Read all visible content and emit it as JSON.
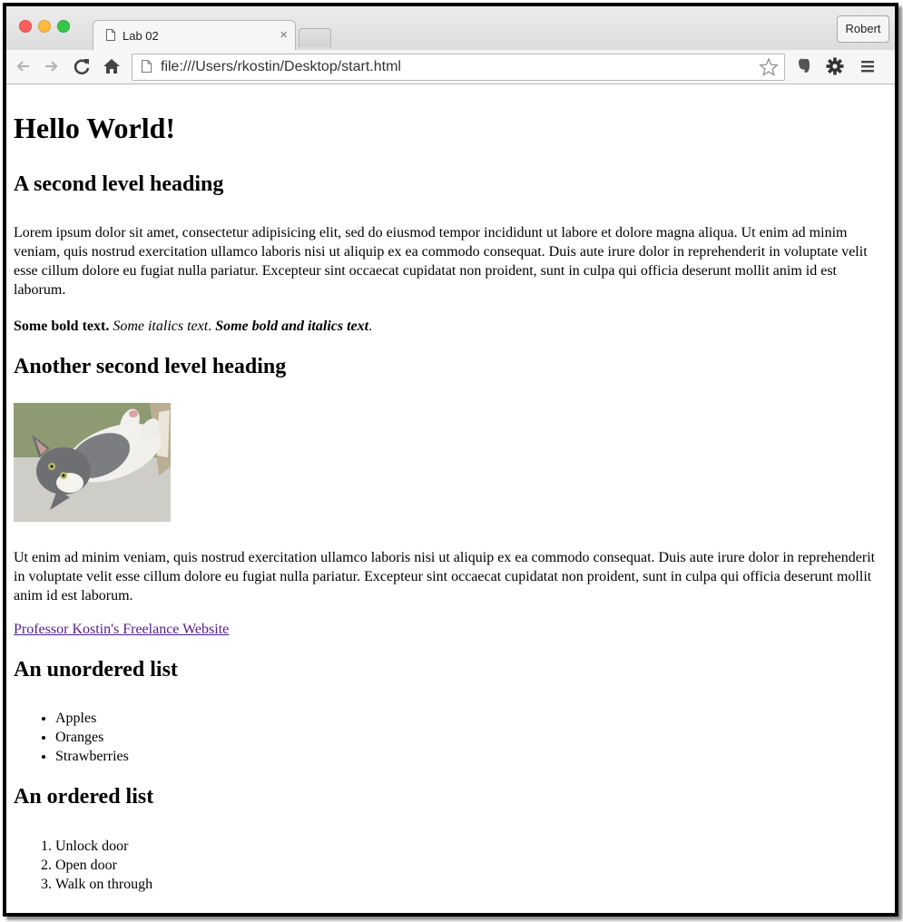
{
  "browser": {
    "tab_title": "Lab 02",
    "tab_close": "×",
    "profile_label": "Robert",
    "url": "file:///Users/rkostin/Desktop/start.html",
    "icons": [
      "back-icon",
      "forward-icon",
      "reload-icon",
      "home-icon",
      "bookmark-star-icon",
      "evernote-icon",
      "settings-gear-icon",
      "menu-icon"
    ]
  },
  "page": {
    "h1": "Hello World!",
    "h2_first": "A second level heading",
    "paragraph_1": "Lorem ipsum dolor sit amet, consectetur adipisicing elit, sed do eiusmod tempor incididunt ut labore et dolore magna aliqua. Ut enim ad minim veniam, quis nostrud exercitation ullamco laboris nisi ut aliquip ex ea commodo consequat. Duis aute irure dolor in reprehenderit in voluptate velit esse cillum dolore eu fugiat nulla pariatur. Excepteur sint occaecat cupidatat non proident, sunt in culpa qui officia deserunt mollit anim id est laborum.",
    "bold_text": "Some bold text.",
    "italic_text": "Some italics text",
    "bold_italic_text": "Some bold and italics text",
    "sep_1": ". ",
    "sep_2": ".",
    "h2_second": "Another second level heading",
    "paragraph_2": "Ut enim ad minim veniam, quis nostrud exercitation ullamco laboris nisi ut aliquip ex ea commodo consequat. Duis aute irure dolor in reprehenderit in voluptate velit esse cillum dolore eu fugiat nulla pariatur. Excepteur sint occaecat cupidatat non proident, sunt in culpa qui officia deserunt mollit anim id est laborum.",
    "link_text": "Professor Kostin's Freelance Website",
    "h2_unordered": "An unordered list",
    "unordered_items": [
      "Apples",
      "Oranges",
      "Strawberries"
    ],
    "h2_ordered": "An ordered list",
    "ordered_items": [
      "Unlock door",
      "Open door",
      "Walk on through"
    ]
  },
  "colors": {
    "link_visited": "#551a8b",
    "traffic_red": "#fc605c",
    "traffic_yellow": "#fdbc40",
    "traffic_green": "#34c84a"
  }
}
